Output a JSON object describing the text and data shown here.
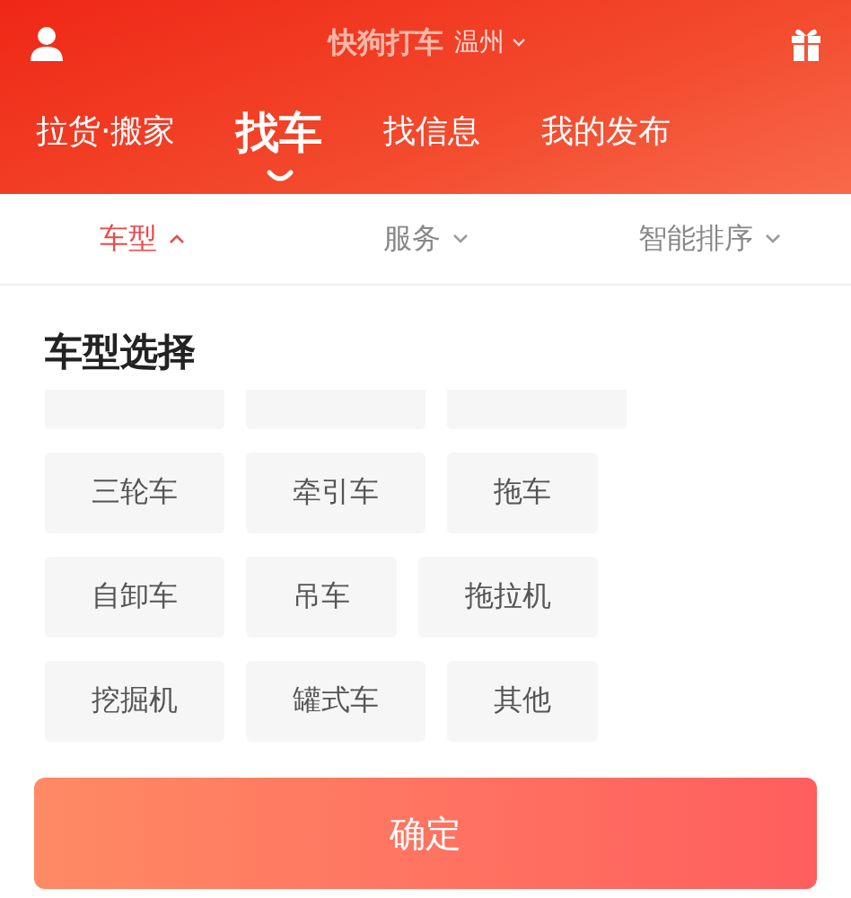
{
  "header": {
    "app_name": "快狗打车",
    "city": "温州"
  },
  "tabs": [
    {
      "label": "拉货·搬家",
      "selected": false
    },
    {
      "label": "找车",
      "selected": true
    },
    {
      "label": "找信息",
      "selected": false
    },
    {
      "label": "我的发布",
      "selected": false
    }
  ],
  "filters": [
    {
      "label": "车型",
      "selected": true
    },
    {
      "label": "服务",
      "selected": false
    },
    {
      "label": "智能排序",
      "selected": false
    }
  ],
  "panel": {
    "title": "车型选择",
    "types": [
      [
        "三轮车",
        "牵引车",
        "拖车"
      ],
      [
        "自卸车",
        "吊车",
        "拖拉机"
      ],
      [
        "挖掘机",
        "罐式车",
        "其他"
      ]
    ]
  },
  "confirm_button": "确定"
}
